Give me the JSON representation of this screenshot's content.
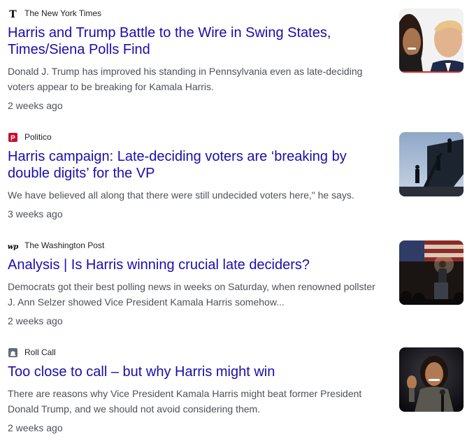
{
  "articles": [
    {
      "source": "The New York Times",
      "source_icon": "nyt-logo-icon",
      "headline": "Harris and Trump Battle to the Wire in Swing States, Times/Siena Polls Find",
      "snippet": "Donald J. Trump has improved his standing in Pennsylvania even as late-deciding voters appear to be breaking for Kamala Harris.",
      "time": "2 weeks ago",
      "thumbnail": "harris-trump-portrait-thumbnail"
    },
    {
      "source": "Politico",
      "source_icon": "politico-logo-icon",
      "headline": "Harris campaign: Late-deciding voters are ‘breaking by double digits’ for the VP",
      "snippet": "We have believed all along that there were still undecided voters here,\" he says.",
      "time": "3 weeks ago",
      "thumbnail": "airplane-stairs-silhouette-thumbnail"
    },
    {
      "source": "The Washington Post",
      "source_icon": "wapo-logo-icon",
      "headline": "Analysis | Is Harris winning crucial late deciders?",
      "snippet": "Democrats got their best polling news in weeks on Saturday, when renowned pollster J. Ann Selzer showed Vice President Kamala Harris somehow...",
      "time": "2 weeks ago",
      "thumbnail": "rally-stage-flag-thumbnail"
    },
    {
      "source": "Roll Call",
      "source_icon": "rollcall-logo-icon",
      "headline": "Too close to call – but why Harris might win",
      "snippet": "There are reasons why Vice President Kamala Harris might beat former President Donald Trump, and we should not avoid considering them.",
      "time": "2 weeks ago",
      "thumbnail": "harris-speaking-thumbnail"
    }
  ],
  "colors": {
    "headline": "#1a0dab",
    "snippet": "#4d5156",
    "source": "#202124",
    "politico_red": "#c8102e",
    "rollcall_bg": "#5f6b7a"
  }
}
